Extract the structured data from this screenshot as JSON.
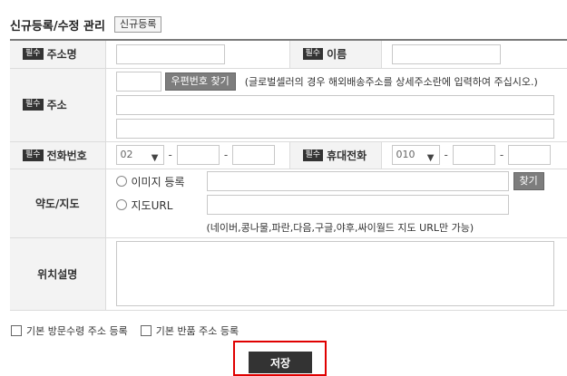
{
  "header": {
    "title": "신규등록/수정 관리",
    "new_button": "신규등록"
  },
  "required_badge": "필수",
  "fields": {
    "name_label": "주소명",
    "recipient_label": "이름",
    "address_label": "주소",
    "zip_button": "우편번호 찾기",
    "address_note": "(글로벌셀러의 경우 해외배송주소를 상세주소란에 입력하여 주십시오.)",
    "phone_label": "전화번호",
    "phone_prefix": "02",
    "mobile_label": "휴대전화",
    "mobile_prefix": "010",
    "map_label": "약도/지도",
    "map_option_image": "이미지 등록",
    "map_option_url": "지도URL",
    "find_button": "찾기",
    "map_note": "(네이버,콩나물,파란,다음,구글,야후,싸이월드 지도 URL만 가능)",
    "location_label": "위치설명"
  },
  "options": {
    "default_visit": "기본 방문수령 주소 등록",
    "default_return": "기본 반품 주소 등록"
  },
  "save_button": "저장"
}
